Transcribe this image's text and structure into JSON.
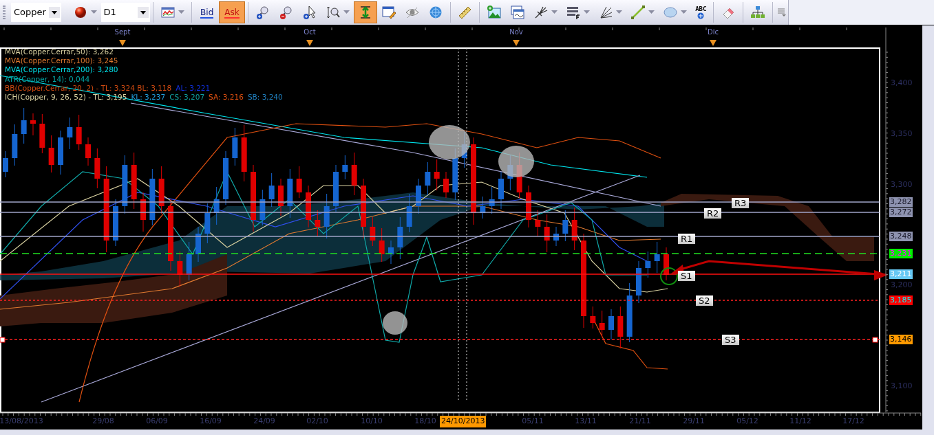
{
  "toolbar": {
    "symbol": "Copper",
    "timeframe": "D1",
    "quotes": [
      {
        "label": "Bid",
        "selected": false
      },
      {
        "label": "Ask",
        "selected": true
      }
    ],
    "tools": [
      {
        "selected": false,
        "menu": true
      },
      {
        "selected": false,
        "menu": true
      },
      {
        "selected": false,
        "menu": false
      },
      {
        "selected": false,
        "menu": false
      },
      {
        "selected": false,
        "menu": false
      },
      {
        "selected": false,
        "menu": true
      },
      {
        "selected": true,
        "menu": false
      },
      {
        "selected": false,
        "menu": false
      },
      {
        "selected": false,
        "menu": false
      },
      {
        "selected": false,
        "menu": false
      },
      {
        "selected": false,
        "menu": false
      },
      {
        "selected": false,
        "menu": false
      },
      {
        "selected": false,
        "menu": false
      },
      {
        "selected": false,
        "menu": true
      },
      {
        "selected": false,
        "menu": true
      },
      {
        "selected": false,
        "menu": true
      },
      {
        "selected": false,
        "menu": true
      },
      {
        "selected": false,
        "menu": true
      },
      {
        "selected": false,
        "menu": false,
        "label": "ABC"
      },
      {
        "selected": false,
        "menu": false
      },
      {
        "selected": false,
        "menu": false
      }
    ]
  },
  "months": [
    "Sept",
    "Oct",
    "Nov",
    "Dic"
  ],
  "legend": [
    [
      {
        "text": "MVA(Copper.Cerrar,50): 3,262",
        "color": "#d8d0a0"
      }
    ],
    [
      {
        "text": "MVA(Copper.Cerrar,100): 3,245",
        "color": "#e07a30"
      }
    ],
    [
      {
        "text": "MVA(Copper.Cerrar,200): 3,280",
        "color": "#00e5ee"
      }
    ],
    [
      {
        "text": "ATR(Copper, 14): 0,044",
        "color": "#00a8a8"
      }
    ],
    [
      {
        "text": "BB(Copper.Cerrar, 20, 2) -   TL: 3,324  BL: 3,118",
        "color": "#d04a10"
      },
      {
        "text": "AL: 3,221",
        "color": "#1030e0"
      }
    ],
    [
      {
        "text": "ICH(Copper, 9, 26, 52) -   TL: 3,195",
        "color": "#d8d0a0"
      },
      {
        "text": "KL: 3,237",
        "color": "#20a0e0"
      },
      {
        "text": "CS: 3,207",
        "color": "#10a0a0"
      },
      {
        "text": "SA: 3,216",
        "color": "#e05010"
      },
      {
        "text": "SB: 3,240",
        "color": "#2080c0"
      }
    ]
  ],
  "price_axis": {
    "ticks": [
      "3,400",
      "3,350",
      "3,300",
      "3,200",
      "3,100"
    ],
    "tags": [
      {
        "text": "3,282",
        "color": "#8e93b0"
      },
      {
        "text": "3,272",
        "color": "#8e93b0"
      },
      {
        "text": "3,248",
        "color": "#8e93b0"
      },
      {
        "text": "3,231",
        "color": "#00ee00"
      },
      {
        "text": "3,211",
        "color": "#66c8f4"
      },
      {
        "text": "3,185",
        "color": "#ff0000"
      },
      {
        "text": "3,146",
        "color": "#ff9900"
      }
    ]
  },
  "levels": [
    "R3",
    "R2",
    "R1",
    "S1",
    "S2",
    "S3"
  ],
  "date_axis": {
    "dates": [
      "13/08/2013",
      "29/08",
      "06/09",
      "16/09",
      "24/09",
      "02/10",
      "10/10",
      "18/10",
      "05/11",
      "13/11",
      "21/11",
      "29/11",
      "05/12",
      "11/12",
      "17/12"
    ],
    "cursor_date": "24/10/2013"
  }
}
